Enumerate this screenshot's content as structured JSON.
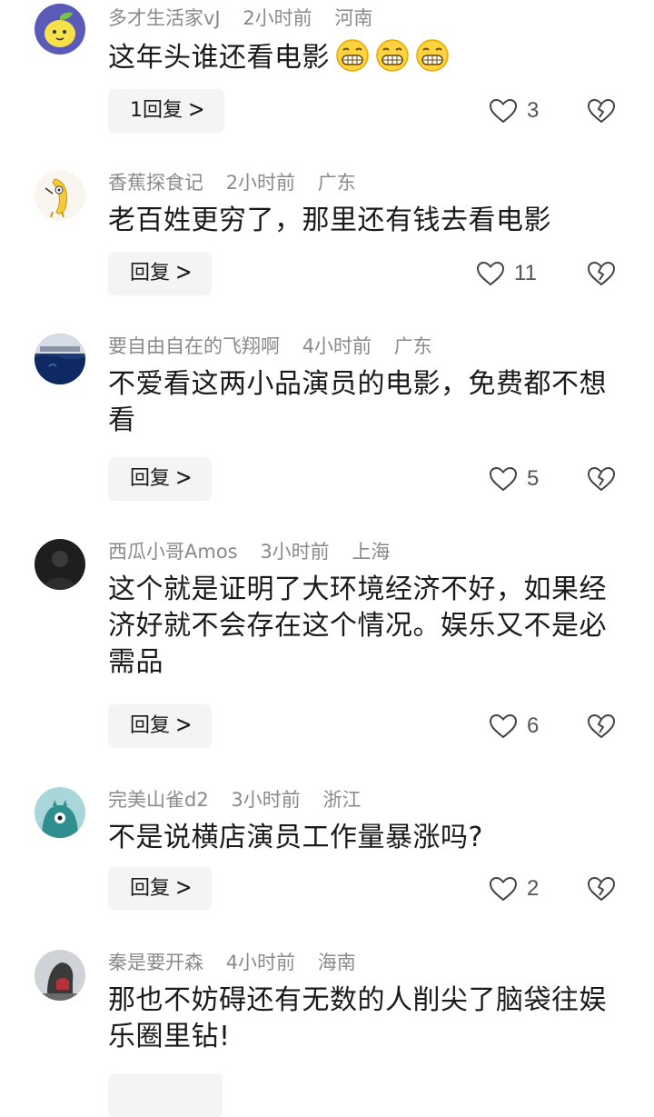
{
  "comments": [
    {
      "username": "多才生活家vJ",
      "time": "2小时前",
      "location": "河南",
      "text": "这年头谁还看电影",
      "emojis": [
        "grin-emoji",
        "grin-emoji",
        "grin-emoji"
      ],
      "reply_label": "1回复",
      "likes": "3",
      "avatar": "lemon-avatar"
    },
    {
      "username": "香蕉探食记",
      "time": "2小时前",
      "location": "广东",
      "text": "老百姓更穷了，那里还有钱去看电影",
      "emojis": [],
      "reply_label": "回复",
      "likes": "11",
      "avatar": "banana-avatar"
    },
    {
      "username": "要自由自在的飞翔啊",
      "time": "4小时前",
      "location": "广东",
      "text": "不爱看这两小品演员的电影，免费都不想看",
      "emojis": [],
      "reply_label": "回复",
      "likes": "5",
      "avatar": "ocean-avatar"
    },
    {
      "username": "西瓜小哥Amos",
      "time": "3小时前",
      "location": "上海",
      "text": "这个就是证明了大环境经济不好，如果经济好就不会存在这个情况。娱乐又不是必需品",
      "emojis": [],
      "reply_label": "回复",
      "likes": "6",
      "avatar": "dark-avatar"
    },
    {
      "username": "完美山雀d2",
      "time": "3小时前",
      "location": "浙江",
      "text": "不是说横店演员工作量暴涨吗?",
      "emojis": [],
      "reply_label": "回复",
      "likes": "2",
      "avatar": "teal-monster-avatar"
    },
    {
      "username": "秦是要开森",
      "time": "4小时前",
      "location": "海南",
      "text": "那也不妨碍还有无数的人削尖了脑袋往娱乐圈里钻!",
      "emojis": [],
      "reply_label": "",
      "likes": "",
      "avatar": "lion-statue-avatar"
    }
  ],
  "colors": {
    "meta": "#8a8a8a",
    "text": "#1a1a1a",
    "reply_bg": "#f4f4f4",
    "icon": "#444444"
  }
}
